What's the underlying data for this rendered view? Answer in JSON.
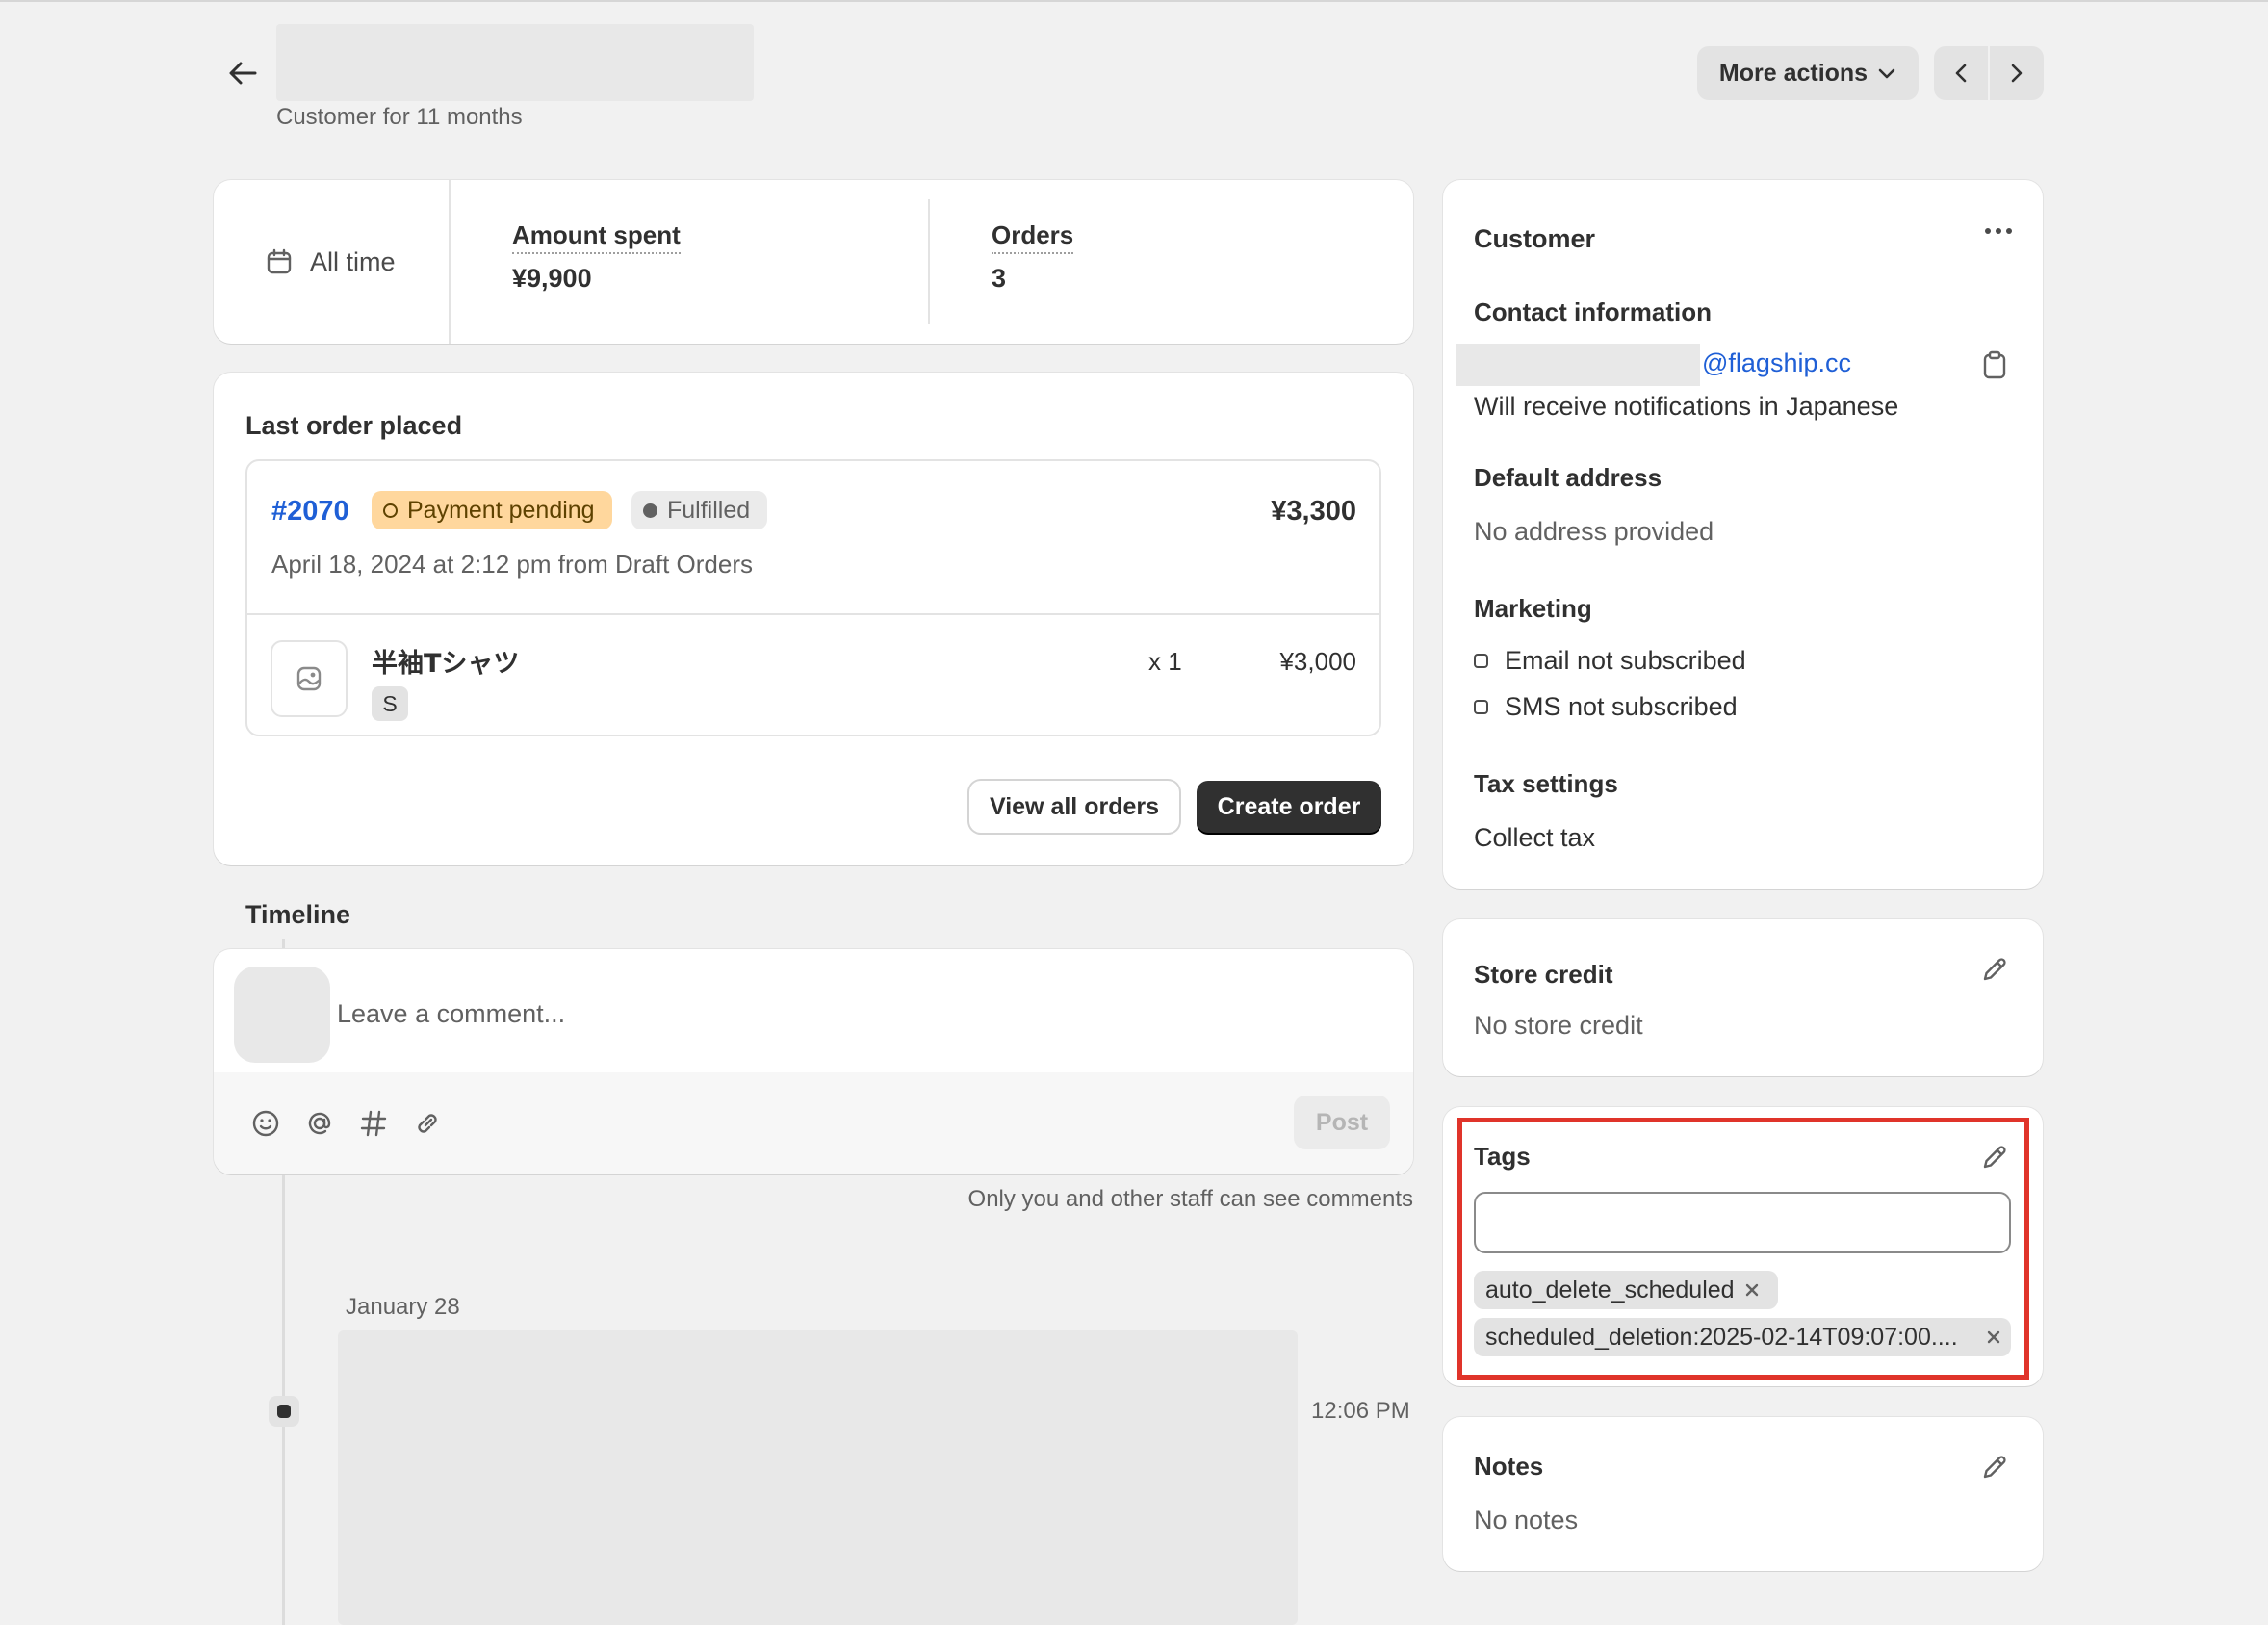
{
  "header": {
    "subtitle": "Customer for 11 months",
    "more_actions_label": "More actions"
  },
  "stats": {
    "range_label": "All time",
    "amount_spent_label": "Amount spent",
    "amount_spent_value": "¥9,900",
    "orders_label": "Orders",
    "orders_value": "3"
  },
  "last_order": {
    "title": "Last order placed",
    "order_number": "#2070",
    "payment_badge": "Payment pending",
    "fulfillment_badge": "Fulfilled",
    "total": "¥3,300",
    "date_source": "April 18, 2024 at 2:12 pm from Draft Orders",
    "item": {
      "name": "半袖Tシャツ",
      "variant": "S",
      "quantity": "x 1",
      "price": "¥3,000"
    },
    "view_all_label": "View all orders",
    "create_order_label": "Create order"
  },
  "timeline": {
    "title": "Timeline",
    "comment_placeholder": "Leave a comment...",
    "post_label": "Post",
    "staff_note": "Only you and other staff can see comments",
    "date": "January 28",
    "event_time": "12:06 PM"
  },
  "customer": {
    "title": "Customer",
    "contact_heading": "Contact information",
    "email_domain": "@flagship.cc",
    "notification_language": "Will receive notifications in Japanese",
    "address_heading": "Default address",
    "address_value": "No address provided",
    "marketing_heading": "Marketing",
    "email_marketing": "Email not subscribed",
    "sms_marketing": "SMS not subscribed",
    "tax_heading": "Tax settings",
    "tax_value": "Collect tax"
  },
  "store_credit": {
    "title": "Store credit",
    "value": "No store credit"
  },
  "tags": {
    "title": "Tags",
    "input_value": "",
    "items": [
      "auto_delete_scheduled",
      "scheduled_deletion:2025-02-14T09:07:00...."
    ]
  },
  "notes": {
    "title": "Notes",
    "value": "No notes"
  },
  "colors": {
    "accent_link": "#1f5fd6",
    "pending_badge": "#ffd79d",
    "highlight_border": "#e0342a",
    "primary_button": "#303030"
  }
}
